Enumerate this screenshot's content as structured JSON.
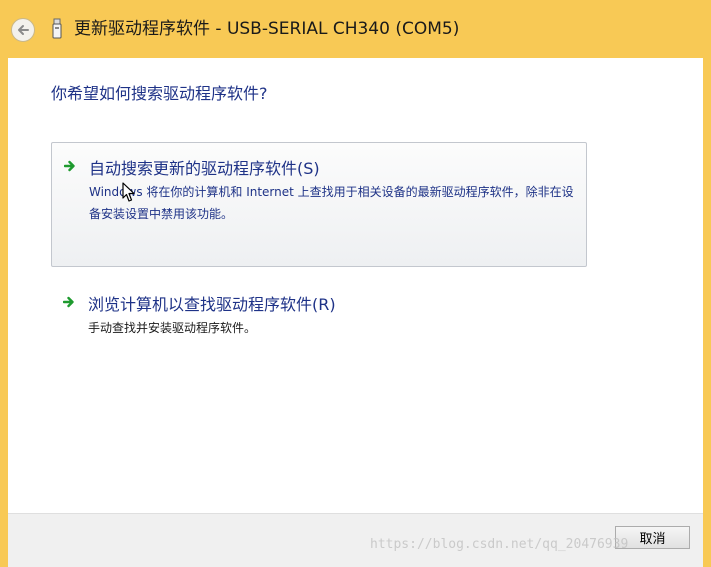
{
  "window": {
    "title": "更新驱动程序软件 - USB-SERIAL CH340 (COM5)",
    "frame_color": "#f8c955"
  },
  "main": {
    "question": "你希望如何搜索驱动程序软件?",
    "options": [
      {
        "title": "自动搜索更新的驱动程序软件(S)",
        "description": "Windows 将在你的计算机和 Internet 上查找用于相关设备的最新驱动程序软件，除非在设备安装设置中禁用该功能。",
        "icon": "green-arrow-icon",
        "selected": true
      },
      {
        "title": "浏览计算机以查找驱动程序软件(R)",
        "description": "手动查找并安装驱动程序软件。",
        "icon": "green-arrow-icon",
        "selected": false
      }
    ],
    "link_color": "#1e3287"
  },
  "footer": {
    "cancel_label": "取消"
  },
  "watermark": "https://blog.csdn.net/qq_20476939"
}
